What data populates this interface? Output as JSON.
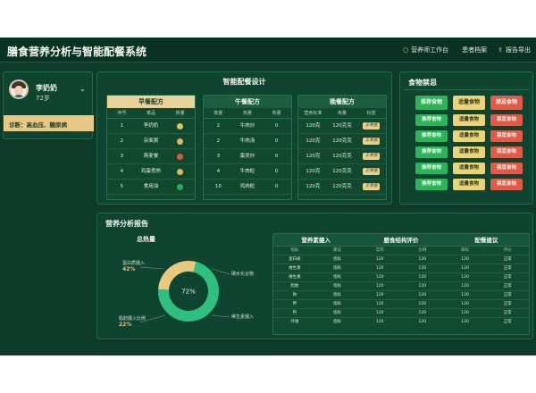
{
  "app": {
    "title": "膳食营养分析与智能配餐系统"
  },
  "nav": [
    {
      "icon": "circle-icon",
      "label": "营养师工作台"
    },
    {
      "icon": "doc-icon",
      "label": "患者档案"
    },
    {
      "icon": "export-icon",
      "label": "报告导出"
    }
  ],
  "patient": {
    "name": "李奶奶",
    "age": "72岁",
    "diagnosis": "诊断：高血压、糖尿病"
  },
  "meal_design": {
    "title": "智能配餐设计",
    "tables": [
      {
        "title": "早餐配方",
        "cols": [
          "序号",
          "菜品",
          "热量"
        ],
        "rows": [
          {
            "no": "1",
            "dish": "李奶奶",
            "color": "#d7c66b"
          },
          {
            "no": "2",
            "dish": "杂面粥",
            "color": "#d8b86c"
          },
          {
            "no": "3",
            "dish": "燕麦餐",
            "color": "#d9584a"
          },
          {
            "no": "4",
            "dish": "鸡蛋煮熟",
            "color": "#d8ba5b"
          },
          {
            "no": "5",
            "dish": "食用油",
            "color": "#2fa962"
          }
        ]
      },
      {
        "title": "午餐配方",
        "cols": [
          "数量",
          "热量",
          "热量"
        ],
        "rows": [
          {
            "no": "2",
            "dish": "牛肉炒",
            "val": "0"
          },
          {
            "no": "2",
            "dish": "牛肉汤",
            "val": "0"
          },
          {
            "no": "3",
            "dish": "蛋类炒",
            "val": "0"
          },
          {
            "no": "4",
            "dish": "牛肉粒",
            "val": "0"
          },
          {
            "no": "10",
            "dish": "鸡肉粒",
            "val": "0"
          }
        ]
      },
      {
        "title": "晚餐配方",
        "cols": [
          "营养标准",
          "热量",
          "标签"
        ],
        "rows": [
          {
            "std": "120克",
            "kcal": "120克克",
            "tag": "正常值"
          },
          {
            "std": "120克",
            "kcal": "120克克",
            "tag": "正常值"
          },
          {
            "std": "120克",
            "kcal": "120克克",
            "tag": "正常值"
          },
          {
            "std": "120克",
            "kcal": "120克克",
            "tag": "正常值"
          },
          {
            "std": "120克",
            "kcal": "120克克",
            "tag": "正常值"
          }
        ]
      }
    ]
  },
  "food_ban": {
    "title": "食物禁忌",
    "headers": [
      "推荐食物",
      "适量食物",
      "禁忌食物"
    ],
    "rows": [
      [
        "推荐食物",
        "适量食物",
        "禁忌食物"
      ],
      [
        "推荐食物",
        "适量食物",
        "禁忌食物"
      ],
      [
        "推荐食物",
        "适量食物",
        "禁忌食物"
      ],
      [
        "推荐食物",
        "适量食物",
        "禁忌食物"
      ],
      [
        "推荐食物",
        "适量食物",
        "禁忌食物"
      ]
    ],
    "colors": {
      "recommended": "#2eb25a",
      "moderate": "#e8d47a",
      "forbidden": "#dd5b49"
    }
  },
  "report": {
    "title": "营养分析报告",
    "total_title": "总热量",
    "center_label": "72%",
    "labels": [
      {
        "name": "蛋白质摄入",
        "value": "42%"
      },
      {
        "name": "脂肪摄入比例",
        "value": "22%"
      },
      {
        "name": "碳水化合物",
        "value": ""
      },
      {
        "name": "维生素摄入",
        "value": ""
      }
    ],
    "analysis_headers": [
      "营养素摄入",
      "膳食结构评价",
      "配餐建议"
    ],
    "analysis_cols": [
      "指标",
      "建议",
      "实际",
      "比例",
      "目标",
      "评价"
    ],
    "analysis_rows": [
      [
        "蛋白质",
        "指标",
        "120",
        "120",
        "120",
        "正常"
      ],
      [
        "维生素",
        "指标",
        "120",
        "120",
        "120",
        "正常"
      ],
      [
        "维生素",
        "指标",
        "120",
        "120",
        "120",
        "正常"
      ],
      [
        "脂肪",
        "指标",
        "120",
        "120",
        "120",
        "正常"
      ],
      [
        "钠",
        "指标",
        "120",
        "120",
        "120",
        "正常"
      ],
      [
        "钾",
        "指标",
        "120",
        "120",
        "120",
        "正常"
      ],
      [
        "钙",
        "指标",
        "120",
        "120",
        "120",
        "正常"
      ],
      [
        "纤维",
        "指标",
        "120",
        "120",
        "120",
        "正常"
      ]
    ]
  },
  "chart_data": {
    "type": "pie",
    "title": "总热量",
    "center_label": "72%",
    "values": [
      72,
      28
    ],
    "colors": [
      "#2fbf7f",
      "#e8c97e"
    ]
  }
}
